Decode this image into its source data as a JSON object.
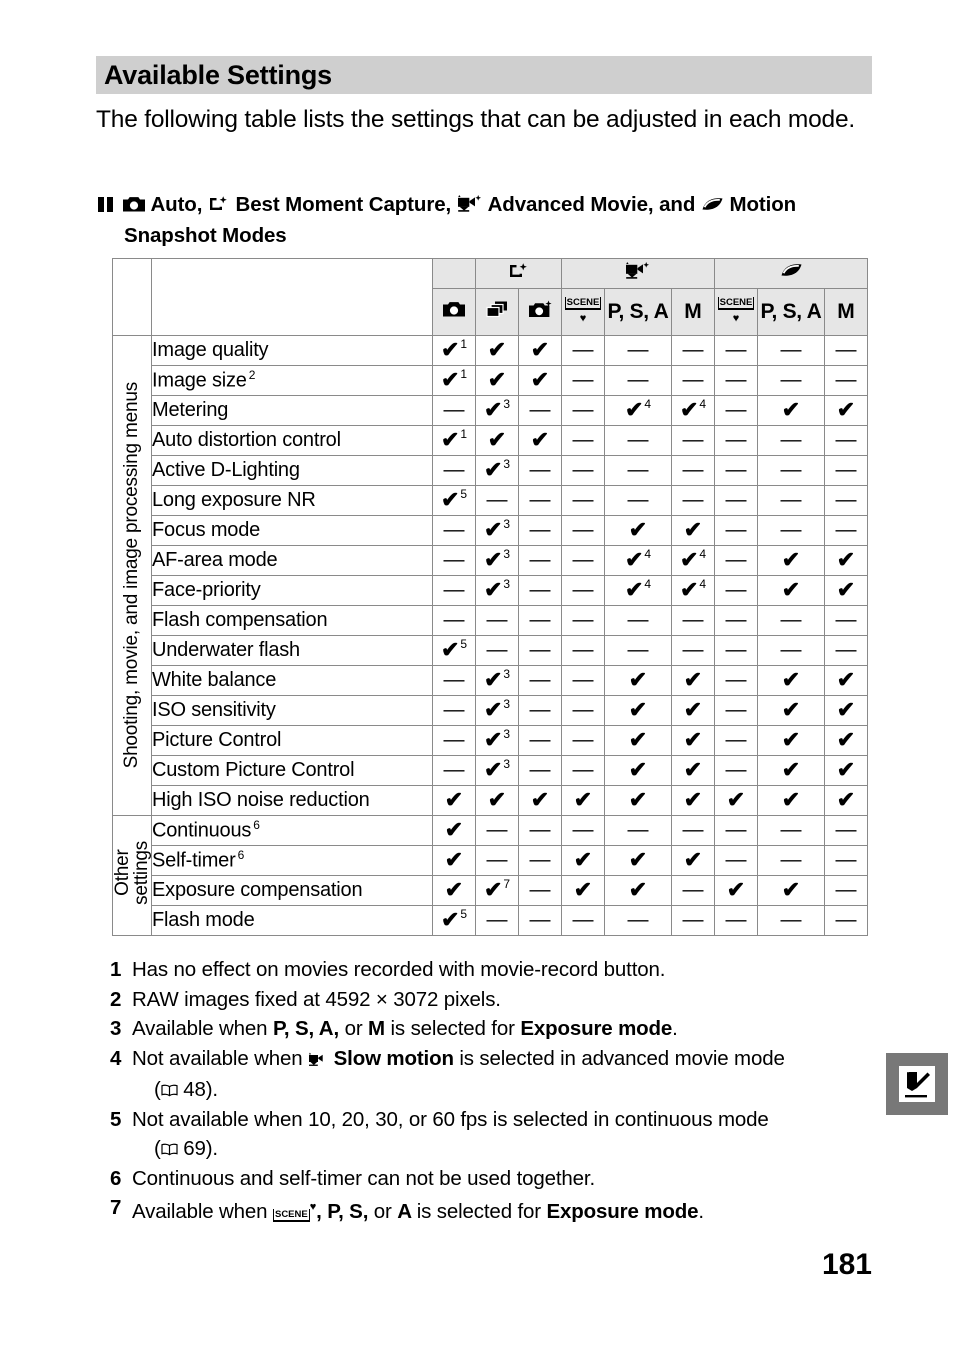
{
  "heading": {
    "title": "Available Settings"
  },
  "intro": {
    "text": "The following table lists the settings that can be adjusted in each mode."
  },
  "subtitle": {
    "line1_a": "Auto,",
    "line1_b": "Best Moment Capture,",
    "line1_c": "Advanced Movie, and",
    "line1_d": "Motion",
    "line2": "Snapshot Modes",
    "icons": [
      "pause-bars-icon",
      "camera-auto-icon",
      "best-moment-capture-icon",
      "advanced-movie-icon",
      "motion-snapshot-icon"
    ]
  },
  "table": {
    "group_headers": [
      {
        "label": "camera-auto-icon",
        "span": 1
      },
      {
        "label": "best-moment-capture-icon",
        "span": 2
      },
      {
        "label": "advanced-movie-icon",
        "span": 3
      },
      {
        "label": "motion-snapshot-icon",
        "span": 3
      }
    ],
    "columns": [
      {
        "key": "auto",
        "label": "camera-auto-icon",
        "type": "icon"
      },
      {
        "key": "bmc_smart",
        "label": "smart-photo-selector-icon",
        "type": "icon"
      },
      {
        "key": "bmc_active",
        "label": "active-selection-icon",
        "type": "icon"
      },
      {
        "key": "am_scene",
        "label": "SCENE",
        "type": "scene"
      },
      {
        "key": "am_psa",
        "label": "P, S, A",
        "type": "text"
      },
      {
        "key": "am_m",
        "label": "M",
        "type": "text"
      },
      {
        "key": "ms_scene",
        "label": "SCENE",
        "type": "scene"
      },
      {
        "key": "ms_psa",
        "label": "P, S, A",
        "type": "text"
      },
      {
        "key": "ms_m",
        "label": "M",
        "type": "text"
      }
    ],
    "row_groups": [
      {
        "label": "Shooting, movie, and image processing menus",
        "rows": 13
      },
      {
        "label_line1": "Other",
        "label_line2": "settings",
        "rows": 4
      }
    ],
    "rows": [
      {
        "name": "Image quality",
        "sup": "",
        "cells": [
          "Y1",
          "Y",
          "Y",
          "-",
          "-",
          "-",
          "-",
          "-",
          "-"
        ]
      },
      {
        "name": "Image size",
        "sup": "2",
        "cells": [
          "Y1",
          "Y",
          "Y",
          "-",
          "-",
          "-",
          "-",
          "-",
          "-"
        ]
      },
      {
        "name": "Metering",
        "sup": "",
        "cells": [
          "-",
          "Y3",
          "-",
          "-",
          "Y4",
          "Y4",
          "-",
          "Y",
          "Y"
        ]
      },
      {
        "name": "Auto distortion control",
        "sup": "",
        "cells": [
          "Y1",
          "Y",
          "Y",
          "-",
          "-",
          "-",
          "-",
          "-",
          "-"
        ]
      },
      {
        "name": "Active D-Lighting",
        "sup": "",
        "cells": [
          "-",
          "Y3",
          "-",
          "-",
          "-",
          "-",
          "-",
          "-",
          "-"
        ]
      },
      {
        "name": "Long exposure NR",
        "sup": "",
        "cells": [
          "Y5",
          "-",
          "-",
          "-",
          "-",
          "-",
          "-",
          "-",
          "-"
        ]
      },
      {
        "name": "Focus mode",
        "sup": "",
        "cells": [
          "-",
          "Y3",
          "-",
          "-",
          "Y",
          "Y",
          "-",
          "-",
          "-"
        ]
      },
      {
        "name": "AF-area mode",
        "sup": "",
        "cells": [
          "-",
          "Y3",
          "-",
          "-",
          "Y4",
          "Y4",
          "-",
          "Y",
          "Y"
        ]
      },
      {
        "name": "Face-priority",
        "sup": "",
        "cells": [
          "-",
          "Y3",
          "-",
          "-",
          "Y4",
          "Y4",
          "-",
          "Y",
          "Y"
        ]
      },
      {
        "name": "Flash compensation",
        "sup": "",
        "cells": [
          "-",
          "-",
          "-",
          "-",
          "-",
          "-",
          "-",
          "-",
          "-"
        ]
      },
      {
        "name": "Underwater flash",
        "sup": "",
        "cells": [
          "Y5",
          "-",
          "-",
          "-",
          "-",
          "-",
          "-",
          "-",
          "-"
        ]
      },
      {
        "name": "White balance",
        "sup": "",
        "cells": [
          "-",
          "Y3",
          "-",
          "-",
          "Y",
          "Y",
          "-",
          "Y",
          "Y"
        ]
      },
      {
        "name": "ISO sensitivity",
        "sup": "",
        "cells": [
          "-",
          "Y3",
          "-",
          "-",
          "Y",
          "Y",
          "-",
          "Y",
          "Y"
        ]
      },
      {
        "name": "Picture Control",
        "sup": "",
        "cells": [
          "-",
          "Y3",
          "-",
          "-",
          "Y",
          "Y",
          "-",
          "Y",
          "Y"
        ]
      },
      {
        "name": "Custom Picture Control",
        "sup": "",
        "cells": [
          "-",
          "Y3",
          "-",
          "-",
          "Y",
          "Y",
          "-",
          "Y",
          "Y"
        ]
      },
      {
        "name": "High ISO noise reduction",
        "sup": "",
        "cells": [
          "Y",
          "Y",
          "Y",
          "Y",
          "Y",
          "Y",
          "Y",
          "Y",
          "Y"
        ]
      },
      {
        "name": "Continuous",
        "sup": "6",
        "cells": [
          "Y",
          "-",
          "-",
          "-",
          "-",
          "-",
          "-",
          "-",
          "-"
        ]
      },
      {
        "name": "Self-timer",
        "sup": "6",
        "cells": [
          "Y",
          "-",
          "-",
          "Y",
          "Y",
          "Y",
          "-",
          "-",
          "-"
        ]
      },
      {
        "name": "Exposure compensation",
        "sup": "",
        "cells": [
          "Y",
          "Y7",
          "-",
          "Y",
          "Y",
          "-",
          "Y",
          "Y",
          "-"
        ]
      },
      {
        "name": "Flash mode",
        "sup": "",
        "cells": [
          "Y5",
          "-",
          "-",
          "-",
          "-",
          "-",
          "-",
          "-",
          "-"
        ]
      }
    ]
  },
  "notes": [
    {
      "num": "1",
      "text": "Has no effect on movies recorded with movie-record button."
    },
    {
      "num": "2",
      "text": "RAW images fixed at 4592 × 3072 pixels."
    },
    {
      "num": "3",
      "pre": "Available when ",
      "modes": "P, S, A, ",
      "mid": "or ",
      "modes2": "M ",
      "post": "is selected for ",
      "bold": "Exposure mode",
      "end": "."
    },
    {
      "num": "4",
      "pre": "Not available when ",
      "bold": "Slow motion",
      "post": " is selected in advanced movie mode",
      "ref": "48",
      "ref_suffix": ")."
    },
    {
      "num": "5",
      "pre": "Not available when 10, 20, 30, or 60 fps is selected in continuous mode",
      "ref": "69",
      "ref_suffix": ")."
    },
    {
      "num": "6",
      "text": "Continuous and self-timer can not be used together."
    },
    {
      "num": "7",
      "pre": "Available when ",
      "scene": "SCENE",
      "mid": ", P, S, ",
      "mid2": "or ",
      "modes2": "A ",
      "post": "is selected for ",
      "bold": "Exposure mode",
      "end": "."
    }
  ],
  "side_tab": {
    "icon": "technical-notes-icon"
  },
  "page_number": "181",
  "colors": {
    "heading_bg": "#cfcfcf",
    "header_cell_bg": "#e6e6e6",
    "border": "#8a8a8a",
    "tab_bg": "#787878"
  }
}
